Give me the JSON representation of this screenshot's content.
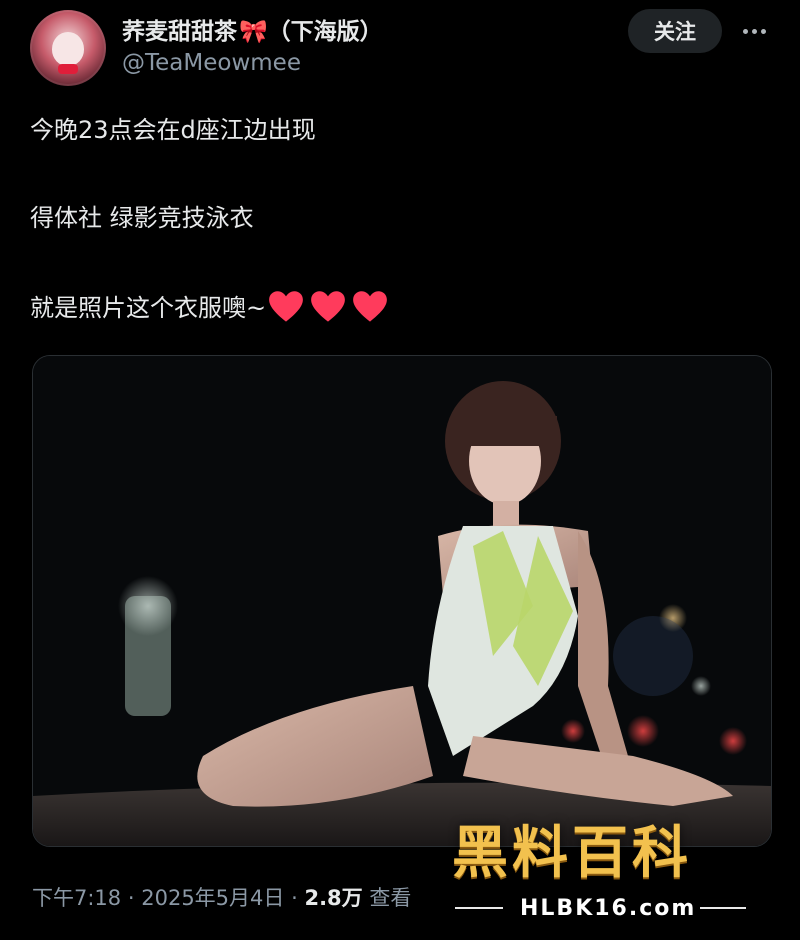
{
  "tweet": {
    "display_name": "荞麦甜甜茶",
    "name_emoji": "🎀",
    "name_suffix": "（下海版）",
    "handle": "@TeaMeowmee",
    "follow_label": "关注",
    "more_icon": "more-horizontal-icon",
    "lines": [
      "今晚23点会在d座江边出现",
      "得体社 绿影竞技泳衣",
      "就是照片这个衣服噢~"
    ],
    "heart_count": 3,
    "heart_color": "#ff3b5c",
    "meta": {
      "time": "下午7:18",
      "separator": "·",
      "date": "2025年5月4日",
      "views": "2.8万",
      "views_label": "查看"
    }
  },
  "watermark": {
    "title": "黑料百科",
    "url": "HLBK16.com",
    "color": "#f2c14e"
  }
}
